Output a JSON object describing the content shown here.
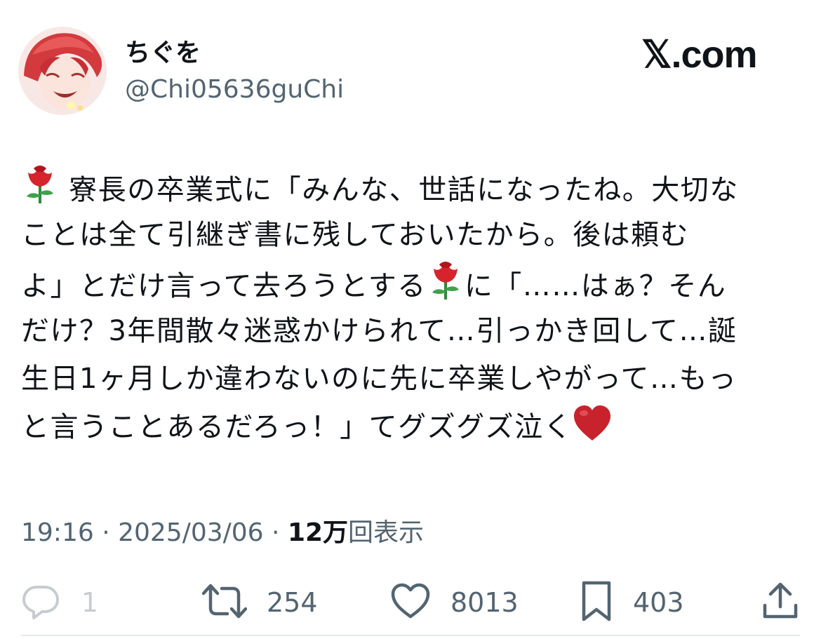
{
  "user": {
    "display_name": "ちぐを",
    "handle": "@Chi05636guChi"
  },
  "brand": {
    "label": "𝕏.com"
  },
  "tweet": {
    "lines": [
      "寮長の卒業式に「みんな、世話になったね。大切な",
      "ことは全て引継ぎ書に残しておいたから。後は頼む",
      "よ」とだけ言って去ろうとする",
      "に「……はぁ？そん",
      "だけ？3年間散々迷惑かけられて…引っかき回して…誕",
      "生日1ヶ月しか違わないのに先に卒業しやがって…もっ",
      "と言うことあるだろっ！」てグズグズ泣く"
    ]
  },
  "meta": {
    "time": "19:16",
    "date": "2025/03/06",
    "views_count": "12万",
    "views_label": "回表示"
  },
  "actions": {
    "reply_count": "1",
    "retweet_count": "254",
    "like_count": "8013",
    "bookmark_count": "403"
  },
  "icons": [
    "rose-emoji",
    "heart-emoji",
    "reply-icon",
    "retweet-icon",
    "like-icon",
    "bookmark-icon",
    "share-icon"
  ],
  "colors": {
    "text": "#0f1419",
    "secondary": "#536471",
    "divider": "#e6e9ea",
    "rose": "#d6242d",
    "heart": "#c8232c"
  }
}
